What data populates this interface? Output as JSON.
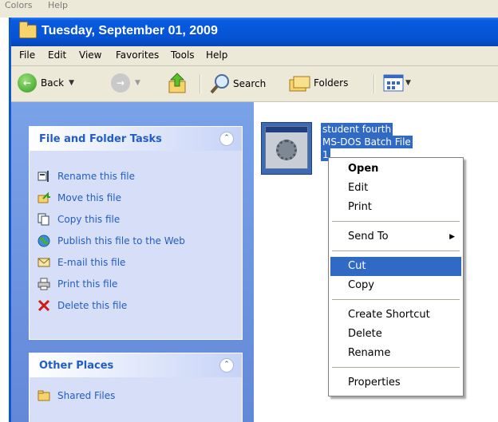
{
  "background_window": {
    "menu": [
      "Colors",
      "Help"
    ]
  },
  "window": {
    "title": "Tuesday, September 01, 2009"
  },
  "menubar": [
    "File",
    "Edit",
    "View",
    "Favorites",
    "Tools",
    "Help"
  ],
  "toolbar": {
    "back_label": "Back",
    "search_label": "Search",
    "folders_label": "Folders"
  },
  "taskpane": {
    "file_tasks": {
      "title": "File and Folder Tasks",
      "items": [
        "Rename this file",
        "Move this file",
        "Copy this file",
        "Publish this file to the Web",
        "E-mail this file",
        "Print this file",
        "Delete this file"
      ]
    },
    "other_places": {
      "title": "Other Places",
      "items": [
        "Shared Files"
      ]
    }
  },
  "file": {
    "name": "student fourth",
    "type": "MS-DOS Batch File",
    "size_fragment": "1"
  },
  "context_menu": {
    "items": [
      "Open",
      "Edit",
      "Print",
      "Send To",
      "Cut",
      "Copy",
      "Create Shortcut",
      "Delete",
      "Rename",
      "Properties"
    ],
    "selected": "Cut"
  },
  "colors": {
    "title_bar": "#0653d4",
    "selection": "#316ac5",
    "task_link": "#215dc6"
  }
}
